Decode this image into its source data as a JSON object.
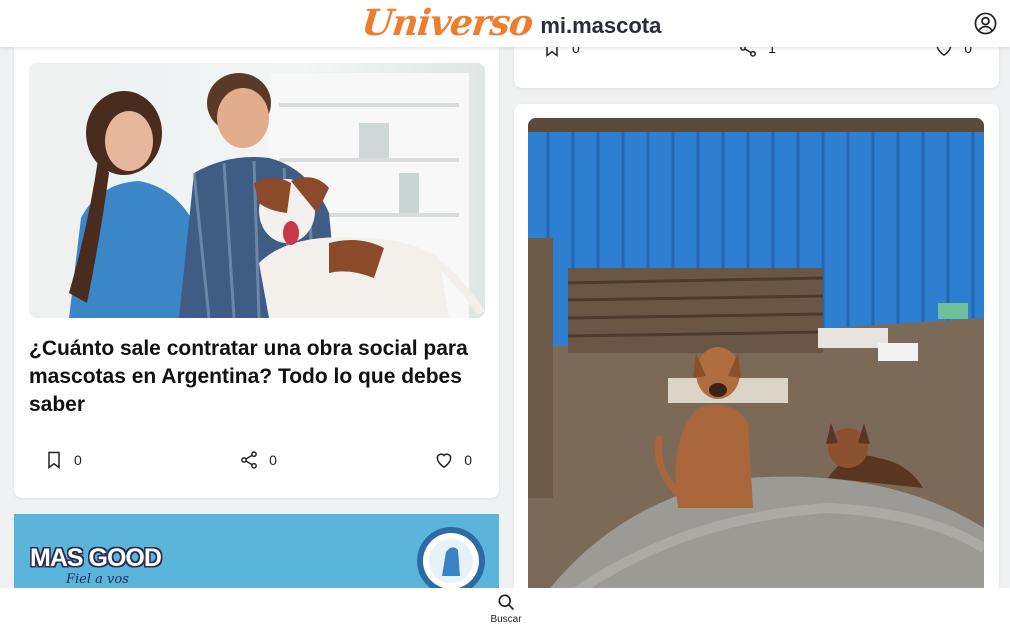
{
  "header": {
    "logo_universo": "Universo",
    "logo_mimascota": "mi.mascota",
    "brand_color": "#f07d2b",
    "user_icon": "user-circle-icon"
  },
  "feed": {
    "top_right_card": {
      "bookmark_count": "0",
      "share_count": "1",
      "like_count": "0"
    },
    "left_card": {
      "title": "¿Cuánto sale contratar una obra social para mascotas en Argentina? Todo lo que debes saber",
      "bookmark_count": "0",
      "share_count": "0",
      "like_count": "0",
      "image": "veterinarian-and-man-with-dog-photo"
    },
    "right_card": {
      "image": "stray-dogs-near-blue-fence-photo"
    },
    "ad_banner": {
      "brand": "MAS GOOD",
      "tagline": "Fiel a vos",
      "background": "#5bb4d9"
    }
  },
  "bottom_nav": {
    "search_label": "Buscar",
    "search_icon": "search-icon"
  }
}
